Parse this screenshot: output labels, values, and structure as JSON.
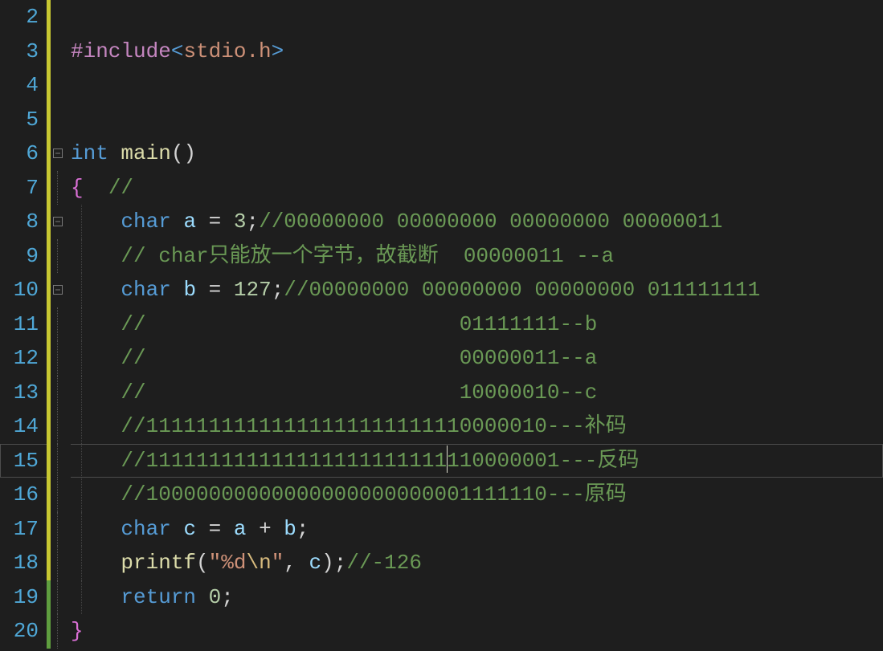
{
  "lines": [
    {
      "num": "2",
      "change": "mod",
      "fold": null,
      "guide": [],
      "active": false,
      "tokens": []
    },
    {
      "num": "3",
      "change": "mod",
      "fold": null,
      "guide": [],
      "active": false,
      "tokens": [
        {
          "c": "pp",
          "t": "#include"
        },
        {
          "c": "ang",
          "t": "<"
        },
        {
          "c": "hdr",
          "t": "stdio.h"
        },
        {
          "c": "ang",
          "t": ">"
        }
      ]
    },
    {
      "num": "4",
      "change": "mod",
      "fold": null,
      "guide": [],
      "active": false,
      "tokens": []
    },
    {
      "num": "5",
      "change": "mod",
      "fold": null,
      "guide": [],
      "active": false,
      "tokens": []
    },
    {
      "num": "6",
      "change": "mod",
      "fold": "open",
      "guide": [],
      "active": false,
      "tokens": [
        {
          "c": "kw",
          "t": "int"
        },
        {
          "c": "op",
          "t": " "
        },
        {
          "c": "fn",
          "t": "main"
        },
        {
          "c": "pn",
          "t": "()"
        }
      ]
    },
    {
      "num": "7",
      "change": "mod",
      "fold": "line",
      "guide": [],
      "active": false,
      "tokens": [
        {
          "c": "brace",
          "t": "{"
        },
        {
          "c": "op",
          "t": "  "
        },
        {
          "c": "cmt",
          "t": "//"
        }
      ]
    },
    {
      "num": "8",
      "change": "mod",
      "fold": "open",
      "guide": [
        1
      ],
      "active": false,
      "tokens": [
        {
          "c": "op",
          "t": "    "
        },
        {
          "c": "kw",
          "t": "char"
        },
        {
          "c": "op",
          "t": " "
        },
        {
          "c": "id",
          "t": "a"
        },
        {
          "c": "op",
          "t": " = "
        },
        {
          "c": "num",
          "t": "3"
        },
        {
          "c": "pn",
          "t": ";"
        },
        {
          "c": "cmt",
          "t": "//00000000 00000000 00000000 00000011"
        }
      ]
    },
    {
      "num": "9",
      "change": "mod",
      "fold": "line",
      "guide": [
        1
      ],
      "active": false,
      "tokens": [
        {
          "c": "op",
          "t": "    "
        },
        {
          "c": "cmt",
          "t": "// char只能放一个字节，故截断  00000011 --a"
        }
      ]
    },
    {
      "num": "10",
      "change": "mod",
      "fold": "open",
      "guide": [
        1
      ],
      "active": false,
      "tokens": [
        {
          "c": "op",
          "t": "    "
        },
        {
          "c": "kw",
          "t": "char"
        },
        {
          "c": "op",
          "t": " "
        },
        {
          "c": "id",
          "t": "b"
        },
        {
          "c": "op",
          "t": " = "
        },
        {
          "c": "num",
          "t": "127"
        },
        {
          "c": "pn",
          "t": ";"
        },
        {
          "c": "cmt",
          "t": "//00000000 00000000 00000000 011111111"
        }
      ]
    },
    {
      "num": "11",
      "change": "mod",
      "fold": "line",
      "guide": [
        1
      ],
      "active": false,
      "tokens": [
        {
          "c": "op",
          "t": "    "
        },
        {
          "c": "cmt",
          "t": "//                         01111111--b"
        }
      ]
    },
    {
      "num": "12",
      "change": "mod",
      "fold": "line",
      "guide": [
        1
      ],
      "active": false,
      "tokens": [
        {
          "c": "op",
          "t": "    "
        },
        {
          "c": "cmt",
          "t": "//                         00000011--a"
        }
      ]
    },
    {
      "num": "13",
      "change": "mod",
      "fold": "line",
      "guide": [
        1
      ],
      "active": false,
      "tokens": [
        {
          "c": "op",
          "t": "    "
        },
        {
          "c": "cmt",
          "t": "//                         10000010--c"
        }
      ]
    },
    {
      "num": "14",
      "change": "mod",
      "fold": "line",
      "guide": [
        1
      ],
      "active": false,
      "tokens": [
        {
          "c": "op",
          "t": "    "
        },
        {
          "c": "cmt",
          "t": "//11111111111111111111111110000010---补码"
        }
      ]
    },
    {
      "num": "15",
      "change": "mod",
      "fold": "line",
      "guide": [
        1
      ],
      "active": true,
      "tokens": [
        {
          "c": "op",
          "t": "    "
        },
        {
          "c": "cmt",
          "t": "//111111111111111111111111"
        },
        {
          "c": "caret",
          "t": ""
        },
        {
          "c": "cmt",
          "t": "110000001---反码"
        }
      ]
    },
    {
      "num": "16",
      "change": "mod",
      "fold": "line",
      "guide": [
        1
      ],
      "active": false,
      "tokens": [
        {
          "c": "op",
          "t": "    "
        },
        {
          "c": "cmt",
          "t": "//10000000000000000000000001111110---原码"
        }
      ]
    },
    {
      "num": "17",
      "change": "mod",
      "fold": "line",
      "guide": [
        1
      ],
      "active": false,
      "tokens": [
        {
          "c": "op",
          "t": "    "
        },
        {
          "c": "kw",
          "t": "char"
        },
        {
          "c": "op",
          "t": " "
        },
        {
          "c": "id",
          "t": "c"
        },
        {
          "c": "op",
          "t": " = "
        },
        {
          "c": "id",
          "t": "a"
        },
        {
          "c": "op",
          "t": " + "
        },
        {
          "c": "id",
          "t": "b"
        },
        {
          "c": "pn",
          "t": ";"
        }
      ]
    },
    {
      "num": "18",
      "change": "mod",
      "fold": "line",
      "guide": [
        1
      ],
      "active": false,
      "tokens": [
        {
          "c": "op",
          "t": "    "
        },
        {
          "c": "fn",
          "t": "printf"
        },
        {
          "c": "pn",
          "t": "("
        },
        {
          "c": "str",
          "t": "\"%d"
        },
        {
          "c": "esc",
          "t": "\\n"
        },
        {
          "c": "str",
          "t": "\""
        },
        {
          "c": "pn",
          "t": ", "
        },
        {
          "c": "id",
          "t": "c"
        },
        {
          "c": "pn",
          "t": ")"
        },
        {
          "c": "pn",
          "t": ";"
        },
        {
          "c": "cmt",
          "t": "//-126"
        }
      ]
    },
    {
      "num": "19",
      "change": "saved",
      "fold": "line",
      "guide": [
        1
      ],
      "active": false,
      "tokens": [
        {
          "c": "op",
          "t": "    "
        },
        {
          "c": "kw",
          "t": "return"
        },
        {
          "c": "op",
          "t": " "
        },
        {
          "c": "num",
          "t": "0"
        },
        {
          "c": "pn",
          "t": ";"
        }
      ]
    },
    {
      "num": "20",
      "change": "saved",
      "fold": "line",
      "guide": [],
      "active": false,
      "tokens": [
        {
          "c": "brace",
          "t": "}"
        }
      ]
    }
  ]
}
